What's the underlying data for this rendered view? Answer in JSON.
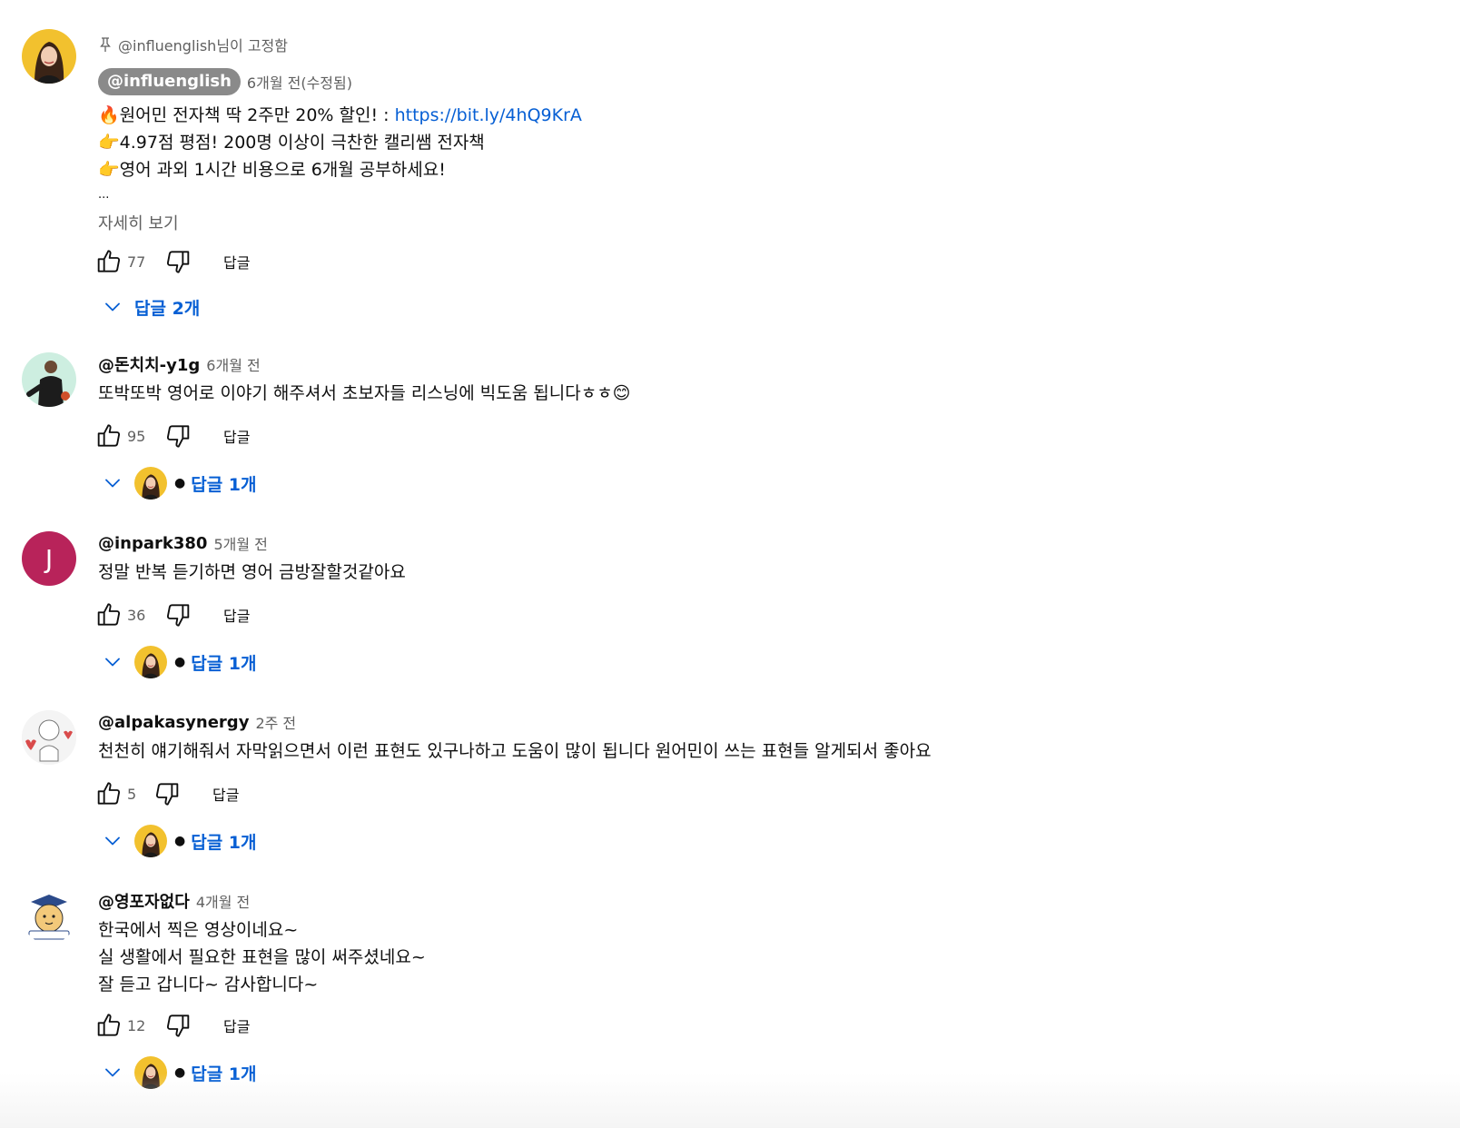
{
  "pinned_comment": {
    "pinned_label": "@influenglish님이 고정함",
    "author": "@influenglish",
    "time": "6개월 전(수정됨)",
    "lines": [
      {
        "emoji": "🔥",
        "text": "원어민 전자책 딱 2주만 20% 할인! : ",
        "link": "https://bit.ly/4hQ9KrA"
      },
      {
        "emoji": "👉",
        "text": "4.97점 평점! 200명 이상이 극찬한 캘리쌤 전자책"
      },
      {
        "emoji": "👉",
        "text": "영어 과외 1시간 비용으로 6개월 공부하세요!"
      }
    ],
    "ellipsis": "...",
    "read_more": "자세히 보기",
    "likes": "77",
    "reply_label": "답글",
    "replies_label": "답글 2개"
  },
  "comments": [
    {
      "author": "@돈치치-y1g",
      "time": "6개월 전",
      "lines": [
        "또박또박 영어로 이야기 해주셔서 초보자들 리스닝에 빅도움 됩니다ㅎㅎ😊"
      ],
      "likes": "95",
      "reply_label": "답글",
      "replies_label": "답글 1개"
    },
    {
      "author": "@inpark380",
      "time": "5개월 전",
      "avatar_letter": "J",
      "lines": [
        "정말 반복 듣기하면 영어 금방잘할것같아요"
      ],
      "likes": "36",
      "reply_label": "답글",
      "replies_label": "답글 1개"
    },
    {
      "author": "@alpakasynergy",
      "time": "2주 전",
      "lines": [
        "천천히 얘기해줘서 자막읽으면서 이런 표현도 있구나하고 도움이 많이 됩니다 원어민이 쓰는 표현들 알게되서 좋아요"
      ],
      "likes": "5",
      "reply_label": "답글",
      "replies_label": "답글 1개"
    },
    {
      "author": "@영포자없다",
      "time": "4개월 전",
      "lines": [
        "한국에서 찍은 영상이네요~",
        "실 생활에서 필요한 표현을 많이 써주셨네요~",
        "잘 듣고 갑니다~ 감사합니다~"
      ],
      "likes": "12",
      "reply_label": "답글",
      "replies_label": "답글 1개"
    }
  ],
  "colors": {
    "link": "#065fd4",
    "secondary_text": "#606060",
    "avatar_j": "#b8235a"
  }
}
